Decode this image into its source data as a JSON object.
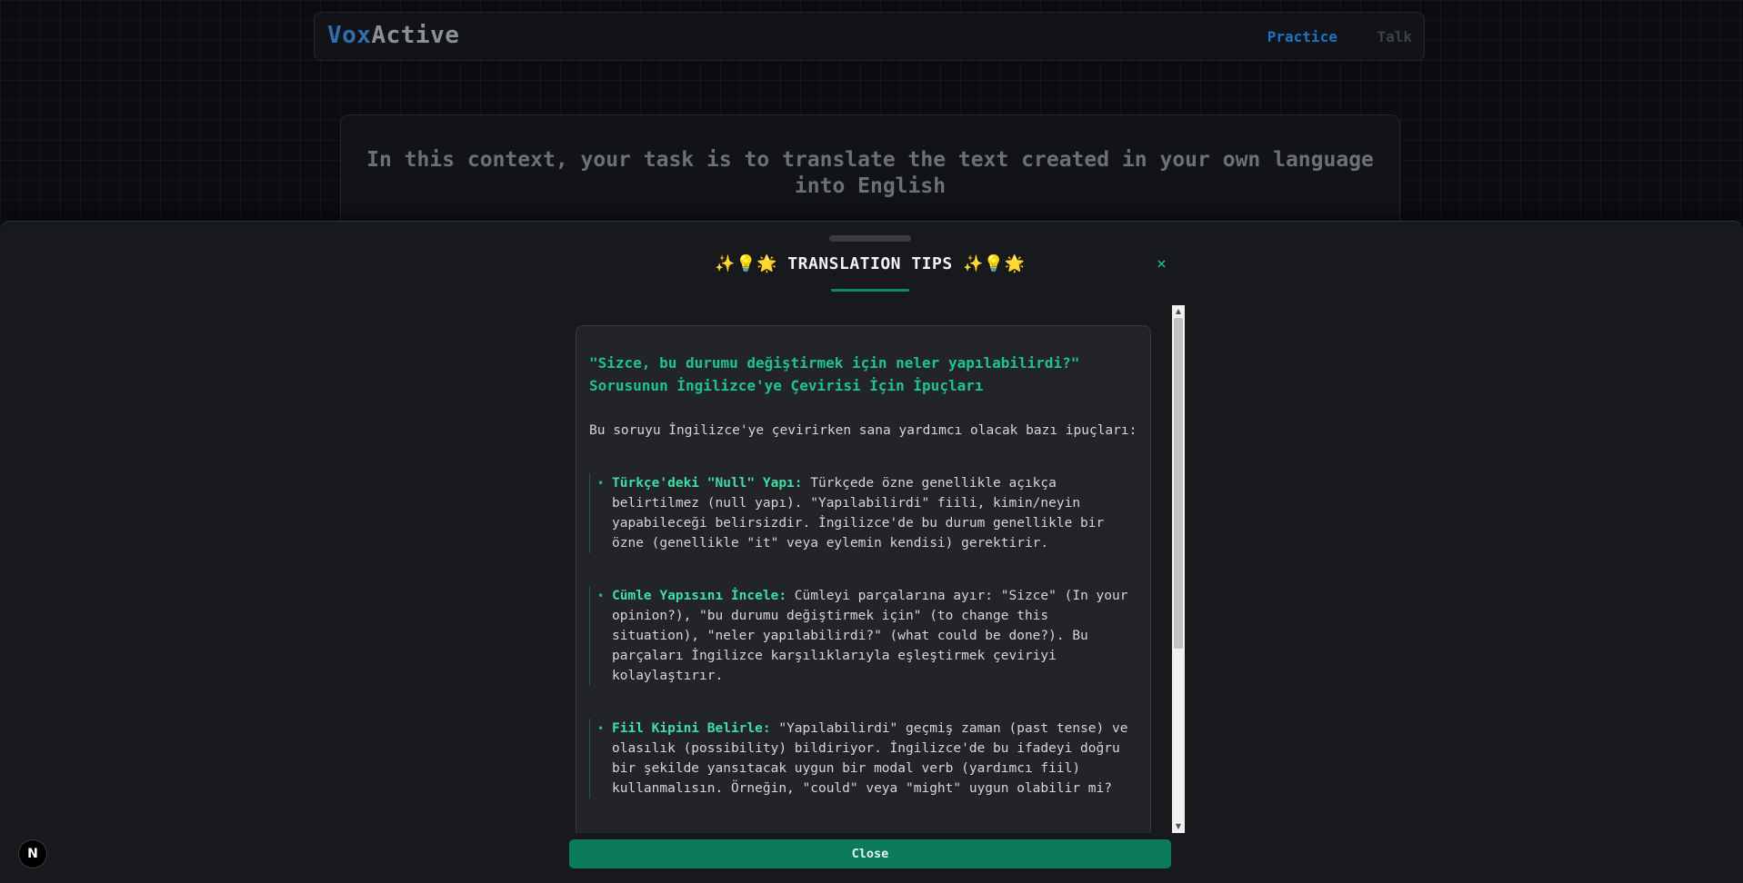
{
  "header": {
    "logo_part1": "Vox",
    "logo_part2": "Active",
    "nav": {
      "practice": "Practice",
      "talk": "Talk"
    }
  },
  "context": {
    "text": "In this context, your task is to translate the text created in your own language into English"
  },
  "modal": {
    "title": "✨💡🌟 TRANSLATION TIPS ✨💡🌟",
    "close_icon": "×",
    "heading": "\"Sizce, bu durumu değiştirmek için neler yapılabilirdi?\" Sorusunun İngilizce'ye Çevirisi İçin İpuçları",
    "intro": "Bu soruyu İngilizce'ye çevirirken sana yardımcı olacak bazı ipuçları:",
    "tips": [
      {
        "label": "Türkçe'deki \"Null\" Yapı:",
        "text": " Türkçede özne genellikle açıkça belirtilmez (null yapı). \"Yapılabilirdi\" fiili, kimin/neyin yapabileceği belirsizdir. İngilizce'de bu durum genellikle bir özne (genellikle \"it\" veya eylemin kendisi) gerektirir."
      },
      {
        "label": "Cümle Yapısını İncele:",
        "text": " Cümleyi parçalarına ayır: \"Sizce\" (In your opinion?), \"bu durumu değiştirmek için\" (to change this situation), \"neler yapılabilirdi?\" (what could be done?). Bu parçaları İngilizce karşılıklarıyla eşleştirmek çeviriyi kolaylaştırır."
      },
      {
        "label": "Fiil Kipini Belirle:",
        "text": " \"Yapılabilirdi\" geçmiş zaman (past tense) ve olasılık (possibility) bildiriyor. İngilizce'de bu ifadeyi doğru bir şekilde yansıtacak uygun bir modal verb (yardımcı fiil) kullanmalısın. Örneğin, \"could\" veya \"might\" uygun olabilir mi?"
      }
    ],
    "close_button": "Close"
  },
  "badge": {
    "letter": "N"
  },
  "icons": {
    "close": "close-icon",
    "bullet": "bullet-icon",
    "scroll_up": "scroll-up-icon",
    "scroll_down": "scroll-down-icon",
    "nextjs": "nextjs-icon"
  },
  "colors": {
    "accent": "#0c7b59",
    "accent_text": "#1ec48e",
    "brand_blue": "#2f6fb1",
    "nav_active": "#1e73c9"
  }
}
